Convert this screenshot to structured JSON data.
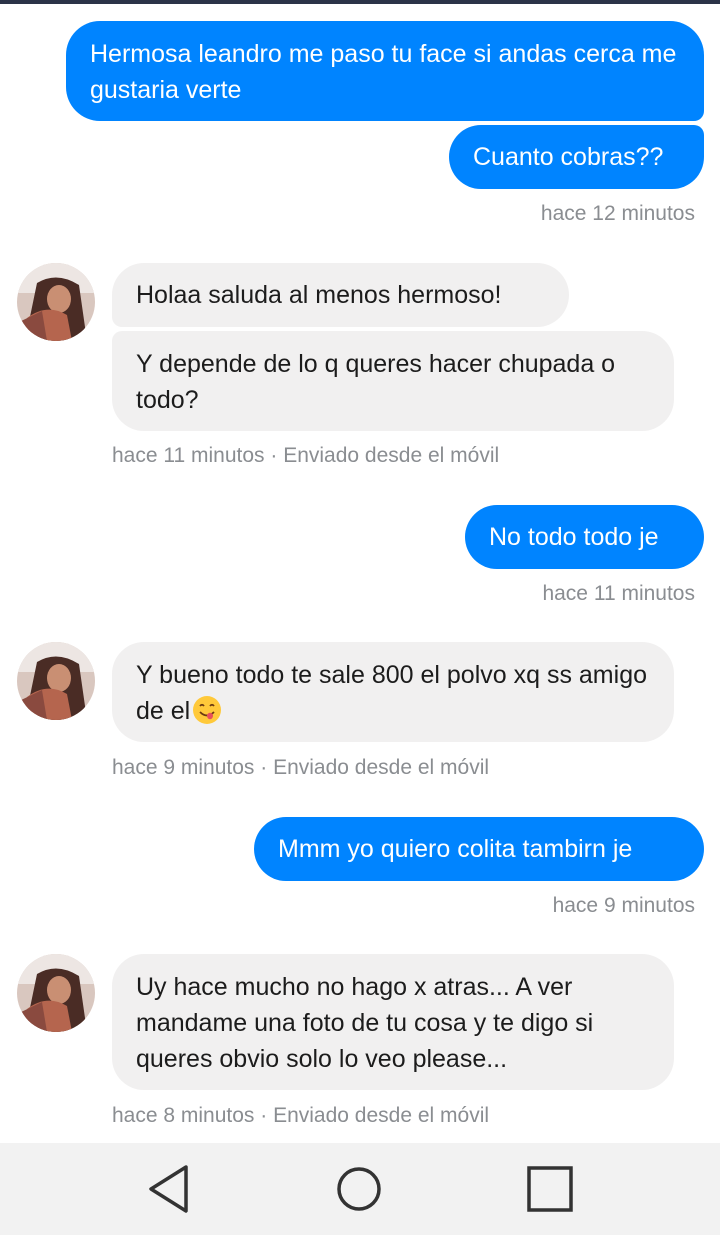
{
  "conversation": {
    "messages": [
      {
        "direction": "out",
        "text": "Hermosa leandro me paso tu face si andas cerca me gustaria verte"
      },
      {
        "direction": "out",
        "text": "Cuanto cobras??",
        "time": "hace 12 minutos"
      },
      {
        "direction": "in",
        "text": "Holaa saluda al menos hermoso!"
      },
      {
        "direction": "in",
        "text": "Y depende de lo q queres hacer chupada o todo?",
        "time": "hace 11 minutos · Enviado desde el móvil"
      },
      {
        "direction": "out",
        "text": "No todo todo je",
        "time": "hace 11 minutos"
      },
      {
        "direction": "in",
        "text": "Y bueno todo te sale 800 el polvo xq ss amigo de el",
        "emoji": "smiling-face-with-tongue",
        "time": "hace 9 minutos · Enviado desde el móvil"
      },
      {
        "direction": "out",
        "text": "Mmm yo quiero colita tambirn je",
        "time": "hace 9 minutos"
      },
      {
        "direction": "in",
        "text": "Uy hace mucho no hago x atras... A ver mandame una foto de tu cosa y te digo si queres obvio solo lo veo please...",
        "time": "hace 8 minutos · Enviado desde el móvil"
      }
    ]
  },
  "colors": {
    "outgoing_bubble": "#0084ff",
    "incoming_bubble": "#f1f0f0",
    "timestamp": "#8a8d91",
    "navbar": "#f2f2f2",
    "status_bar": "#2b3348"
  },
  "navbar": {
    "buttons": [
      "back-icon",
      "home-icon",
      "recents-icon"
    ]
  }
}
